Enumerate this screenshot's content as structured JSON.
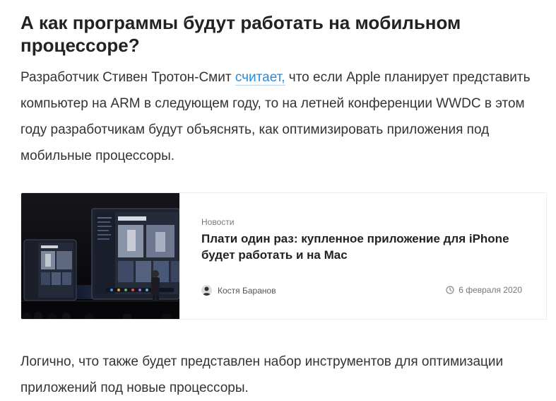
{
  "article": {
    "heading": "А как программы будут работать на мобильном процессоре?",
    "paragraph1": {
      "before_link": "Разработчик Стивен Тротон-Смит ",
      "link": "считает,",
      "after_link": " что если Apple планирует представить компьютер на ARM в следующем году, то на летней конференции WWDC в этом году разработчикам будут объяснять, как оптимизировать приложения под мобильные процессоры."
    },
    "paragraph2": "Логично, что также будет представлен набор инструментов для оптимизации приложений под новые процессоры."
  },
  "card": {
    "category": "Новости",
    "title": "Плати один раз: купленное приложение для iPhone будет работать и на Mac",
    "author": "Костя Баранов",
    "date": "6 февраля 2020",
    "image": "wwdc-stage-photo",
    "author_icon": "avatar",
    "date_icon": "clock-icon"
  },
  "colors": {
    "link": "#2b8cdb",
    "text": "#333333",
    "heading": "#222222",
    "meta": "#777777"
  }
}
